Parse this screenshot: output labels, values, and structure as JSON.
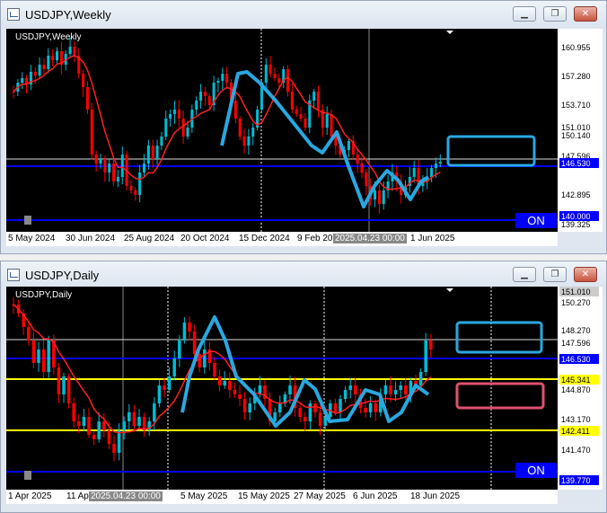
{
  "top_window": {
    "title": "USDJPY,Weekly",
    "chart_label": "USDJPY,Weekly",
    "price_labels": [
      "160.955",
      "157.280",
      "153.710",
      "151.010",
      "150.140",
      "147.596",
      "146.530",
      "142.895",
      "140.000",
      "139.325"
    ],
    "date_labels": [
      "5 May 2024",
      "30 Jun 2024",
      "25 Aug 2024",
      "20 Oct 2024",
      "15 Dec 2024",
      "9 Feb 202",
      "2025.04.23 00:00",
      "1 Jun 2025"
    ],
    "on_label": "ON",
    "horizontal_lines": {
      "white": "147.596",
      "blue": "146.530",
      "blue_bottom": "139.700"
    }
  },
  "bottom_window": {
    "title": "USDJPY,Daily",
    "chart_label": "USDJPY,Daily",
    "price_labels": [
      "151.010",
      "150.270",
      "148.270",
      "147.596",
      "146.530",
      "145.341",
      "144.870",
      "143.170",
      "142.411",
      "141.470",
      "139.770"
    ],
    "date_labels": [
      "1 Apr 2025",
      "11 Ap",
      "2025.04.23 00:00",
      "5 May 2025",
      "15 May 2025",
      "27 May 2025",
      "6 Jun 2025",
      "18 Jun 2025"
    ],
    "on_label": "ON",
    "horizontal_lines": {
      "white": "147.596",
      "blue": "146.530",
      "yellow_top": "145.341",
      "yellow_bottom": "142.411"
    }
  },
  "window_buttons": {
    "minimize": "▁",
    "restore": "❐",
    "close": "✕"
  },
  "colors": {
    "bull": "#00bcd4",
    "bear": "#ff0000",
    "ma": "#ff2020",
    "annotation": "#29a8e0",
    "pink": "#e05070",
    "yellow": "#ffff00",
    "blue": "#0000ff"
  }
}
